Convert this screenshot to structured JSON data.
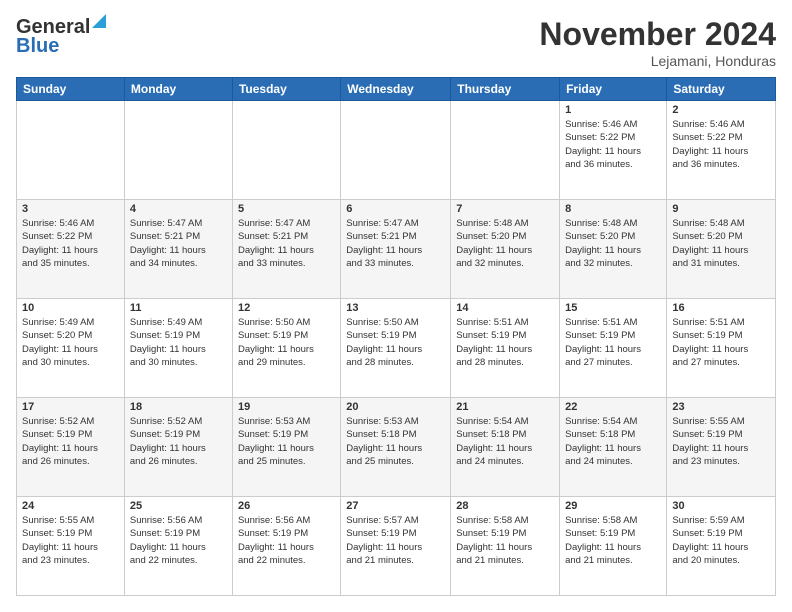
{
  "header": {
    "logo_line1": "General",
    "logo_line2": "Blue",
    "month_title": "November 2024",
    "location": "Lejamani, Honduras"
  },
  "weekdays": [
    "Sunday",
    "Monday",
    "Tuesday",
    "Wednesday",
    "Thursday",
    "Friday",
    "Saturday"
  ],
  "weeks": [
    [
      {
        "day": "",
        "info": ""
      },
      {
        "day": "",
        "info": ""
      },
      {
        "day": "",
        "info": ""
      },
      {
        "day": "",
        "info": ""
      },
      {
        "day": "",
        "info": ""
      },
      {
        "day": "1",
        "info": "Sunrise: 5:46 AM\nSunset: 5:22 PM\nDaylight: 11 hours\nand 36 minutes."
      },
      {
        "day": "2",
        "info": "Sunrise: 5:46 AM\nSunset: 5:22 PM\nDaylight: 11 hours\nand 36 minutes."
      }
    ],
    [
      {
        "day": "3",
        "info": "Sunrise: 5:46 AM\nSunset: 5:22 PM\nDaylight: 11 hours\nand 35 minutes."
      },
      {
        "day": "4",
        "info": "Sunrise: 5:47 AM\nSunset: 5:21 PM\nDaylight: 11 hours\nand 34 minutes."
      },
      {
        "day": "5",
        "info": "Sunrise: 5:47 AM\nSunset: 5:21 PM\nDaylight: 11 hours\nand 33 minutes."
      },
      {
        "day": "6",
        "info": "Sunrise: 5:47 AM\nSunset: 5:21 PM\nDaylight: 11 hours\nand 33 minutes."
      },
      {
        "day": "7",
        "info": "Sunrise: 5:48 AM\nSunset: 5:20 PM\nDaylight: 11 hours\nand 32 minutes."
      },
      {
        "day": "8",
        "info": "Sunrise: 5:48 AM\nSunset: 5:20 PM\nDaylight: 11 hours\nand 32 minutes."
      },
      {
        "day": "9",
        "info": "Sunrise: 5:48 AM\nSunset: 5:20 PM\nDaylight: 11 hours\nand 31 minutes."
      }
    ],
    [
      {
        "day": "10",
        "info": "Sunrise: 5:49 AM\nSunset: 5:20 PM\nDaylight: 11 hours\nand 30 minutes."
      },
      {
        "day": "11",
        "info": "Sunrise: 5:49 AM\nSunset: 5:19 PM\nDaylight: 11 hours\nand 30 minutes."
      },
      {
        "day": "12",
        "info": "Sunrise: 5:50 AM\nSunset: 5:19 PM\nDaylight: 11 hours\nand 29 minutes."
      },
      {
        "day": "13",
        "info": "Sunrise: 5:50 AM\nSunset: 5:19 PM\nDaylight: 11 hours\nand 28 minutes."
      },
      {
        "day": "14",
        "info": "Sunrise: 5:51 AM\nSunset: 5:19 PM\nDaylight: 11 hours\nand 28 minutes."
      },
      {
        "day": "15",
        "info": "Sunrise: 5:51 AM\nSunset: 5:19 PM\nDaylight: 11 hours\nand 27 minutes."
      },
      {
        "day": "16",
        "info": "Sunrise: 5:51 AM\nSunset: 5:19 PM\nDaylight: 11 hours\nand 27 minutes."
      }
    ],
    [
      {
        "day": "17",
        "info": "Sunrise: 5:52 AM\nSunset: 5:19 PM\nDaylight: 11 hours\nand 26 minutes."
      },
      {
        "day": "18",
        "info": "Sunrise: 5:52 AM\nSunset: 5:19 PM\nDaylight: 11 hours\nand 26 minutes."
      },
      {
        "day": "19",
        "info": "Sunrise: 5:53 AM\nSunset: 5:19 PM\nDaylight: 11 hours\nand 25 minutes."
      },
      {
        "day": "20",
        "info": "Sunrise: 5:53 AM\nSunset: 5:18 PM\nDaylight: 11 hours\nand 25 minutes."
      },
      {
        "day": "21",
        "info": "Sunrise: 5:54 AM\nSunset: 5:18 PM\nDaylight: 11 hours\nand 24 minutes."
      },
      {
        "day": "22",
        "info": "Sunrise: 5:54 AM\nSunset: 5:18 PM\nDaylight: 11 hours\nand 24 minutes."
      },
      {
        "day": "23",
        "info": "Sunrise: 5:55 AM\nSunset: 5:19 PM\nDaylight: 11 hours\nand 23 minutes."
      }
    ],
    [
      {
        "day": "24",
        "info": "Sunrise: 5:55 AM\nSunset: 5:19 PM\nDaylight: 11 hours\nand 23 minutes."
      },
      {
        "day": "25",
        "info": "Sunrise: 5:56 AM\nSunset: 5:19 PM\nDaylight: 11 hours\nand 22 minutes."
      },
      {
        "day": "26",
        "info": "Sunrise: 5:56 AM\nSunset: 5:19 PM\nDaylight: 11 hours\nand 22 minutes."
      },
      {
        "day": "27",
        "info": "Sunrise: 5:57 AM\nSunset: 5:19 PM\nDaylight: 11 hours\nand 21 minutes."
      },
      {
        "day": "28",
        "info": "Sunrise: 5:58 AM\nSunset: 5:19 PM\nDaylight: 11 hours\nand 21 minutes."
      },
      {
        "day": "29",
        "info": "Sunrise: 5:58 AM\nSunset: 5:19 PM\nDaylight: 11 hours\nand 21 minutes."
      },
      {
        "day": "30",
        "info": "Sunrise: 5:59 AM\nSunset: 5:19 PM\nDaylight: 11 hours\nand 20 minutes."
      }
    ]
  ]
}
